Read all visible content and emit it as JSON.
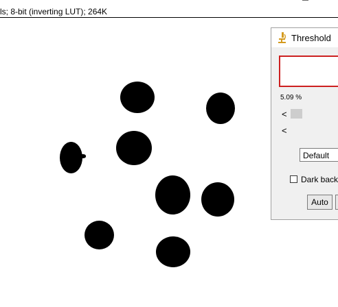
{
  "image_window": {
    "info_text": "ls; 8-bit (inverting LUT); 264K"
  },
  "threshold_dialog": {
    "title": "Threshold",
    "title_icon": "microscope-icon",
    "percent": "5.09 %",
    "arrow_glyph": "<",
    "method": "Default",
    "dark_background_label": "Dark back",
    "dark_background_checked": false,
    "auto_label": "Auto"
  },
  "colors": {
    "histogram_border": "#cc1f1f",
    "icon_accent": "#d49a1e",
    "particles": "#000000"
  }
}
